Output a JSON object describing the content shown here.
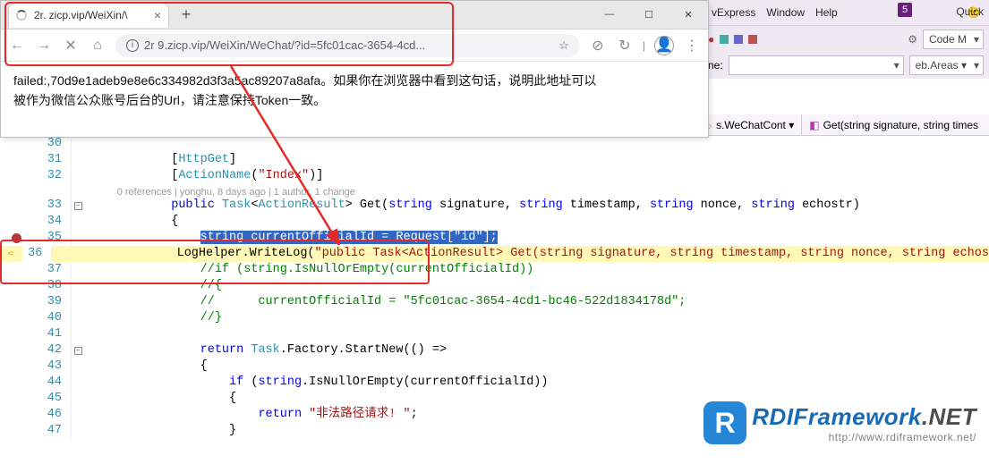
{
  "browser": {
    "tab_title": "2r.            zicp.vip/WeiXin/\\",
    "new_tab": "+",
    "tab_close": "×",
    "sys": {
      "min": "—",
      "max": "☐",
      "close": "✕"
    },
    "nav": {
      "back": "←",
      "fwd": "→",
      "reload": "✕",
      "home": "⌂"
    },
    "url_display": "2r            9.zicp.vip/WeiXin/WeChat/?id=5fc01cac-3654-4cd...",
    "star": "☆",
    "ext1": "⊘",
    "ext2": "↻",
    "user": "👤",
    "menu": "⋮",
    "content_line1": "failed:,70d9e1adeb9e8e6c334982d3f3a5ac89207a8afa。如果你在浏览器中看到这句话，说明此地址可以",
    "content_line2": "被作为微信公众账号后台的Url，请注意保持Token一致。"
  },
  "vs": {
    "badge": "5",
    "quick": "Quick",
    "menus": [
      "vExpress",
      "Window",
      "Help"
    ],
    "toolbar_code_btn": "Code M",
    "combo_left_prefix": "ne:",
    "combo_right": "eb.Areas  ▾",
    "crumb_file": "s.WeChatCont ▾",
    "crumb_method": "Get(string signature, string times"
  },
  "code": {
    "indent_base": "            ",
    "lens_text": "0 references | yonghu, 8 days ago | 1 author, 1 change",
    "l30": "",
    "l31_attr": "[HttpGet]",
    "l32_attr_open": "[ActionName(",
    "l32_attr_str": "\"Index\"",
    "l32_attr_close": ")]",
    "l33_sig1": "public Task<ActionResult> Get(string signature, string timestamp, string nonce, string echostr)",
    "l34_brace": "{",
    "l35": "string currentOfficialId = Request[\"id\"];",
    "l36_a": "LogHelper.WriteLog(",
    "l36_b": "\"public Task<ActionResult> Get(string signature, string timestamp, string nonce, string echos",
    "l37": "//if (string.IsNullOrEmpty(currentOfficialId))",
    "l38": "//{",
    "l39": "//      currentOfficialId = \"5fc01cac-3654-4cd1-bc46-522d1834178d\";",
    "l40": "//}",
    "l41": "",
    "l42_a": "return Task.Factory.StartNew(() =>",
    "l43_brace": "{",
    "l44_a": "if (string.IsNullOrEmpty(currentOfficialId))",
    "l45_brace": "{",
    "l46_a": "return ",
    "l46_str": "\"非法路径请求! \"",
    "l46_end": ";",
    "l47_brace": "}"
  },
  "watermark": {
    "brand": "RDIFramework",
    "tld": ".NET",
    "url": "http://www.rdiframework.net/"
  }
}
